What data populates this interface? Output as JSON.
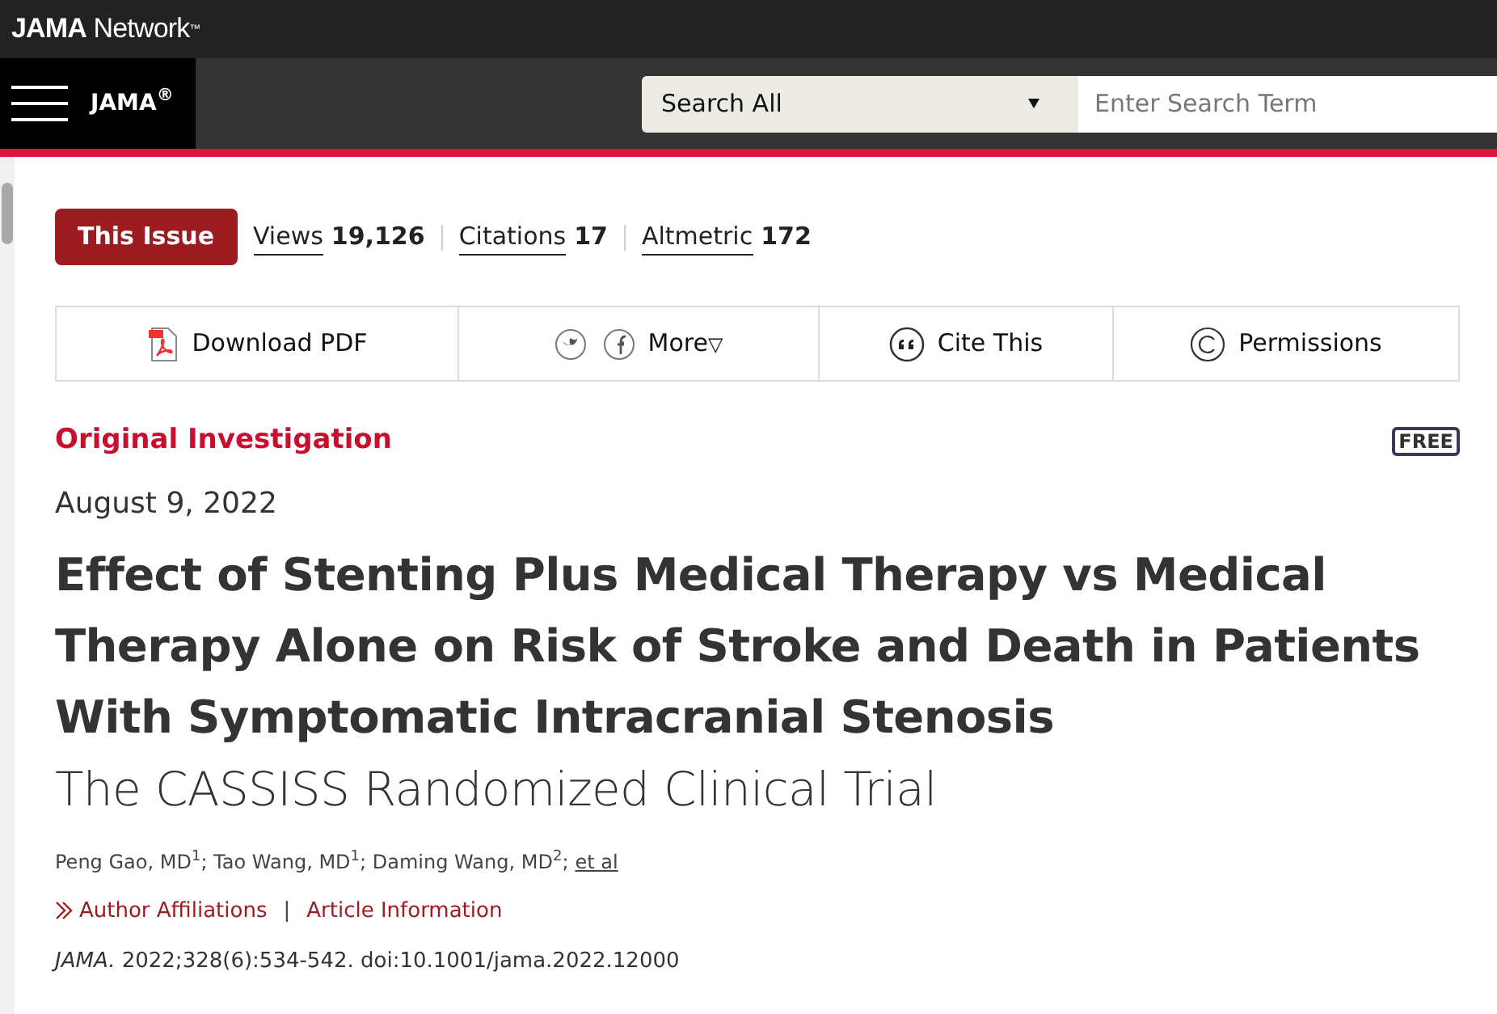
{
  "network_bar": {
    "brand_bold": "JAMA",
    "brand_light": "Network",
    "trademark": "™"
  },
  "nav": {
    "journal": "JAMA",
    "registered": "®",
    "search_scope": "Search All",
    "search_placeholder": "Enter Search Term"
  },
  "metrics": {
    "issue_button": "This Issue",
    "items": [
      {
        "label": "Views",
        "value": "19,126"
      },
      {
        "label": "Citations",
        "value": "17"
      },
      {
        "label": "Altmetric",
        "value": "172"
      }
    ]
  },
  "toolbar": [
    {
      "kind": "pdf",
      "label": "Download PDF"
    },
    {
      "kind": "share",
      "label": "More",
      "caret": "▽"
    },
    {
      "kind": "cite",
      "label": "Cite This"
    },
    {
      "kind": "permissions",
      "label": "Permissions"
    }
  ],
  "article": {
    "type": "Original Investigation",
    "badge": "FREE",
    "date": "August 9, 2022",
    "title": "Effect of Stenting Plus Medical Therapy vs Medical Therapy Alone on Risk of Stroke and Death in Patients With Symptomatic Intracranial Stenosis",
    "subtitle": "The CASSISS Randomized Clinical Trial",
    "authors": "Peng Gao, MD$^{1}$; Tao Wang, MD$^{1}$; Daming Wang, MD$^{2}$;",
    "et_al": "et al",
    "links": [
      "Author Affiliations",
      "Article Information"
    ],
    "link_separator": "|",
    "citation": "*JAMA.* 2022;328(6):534-542. doi:10.1001/jama.2022.12000"
  }
}
